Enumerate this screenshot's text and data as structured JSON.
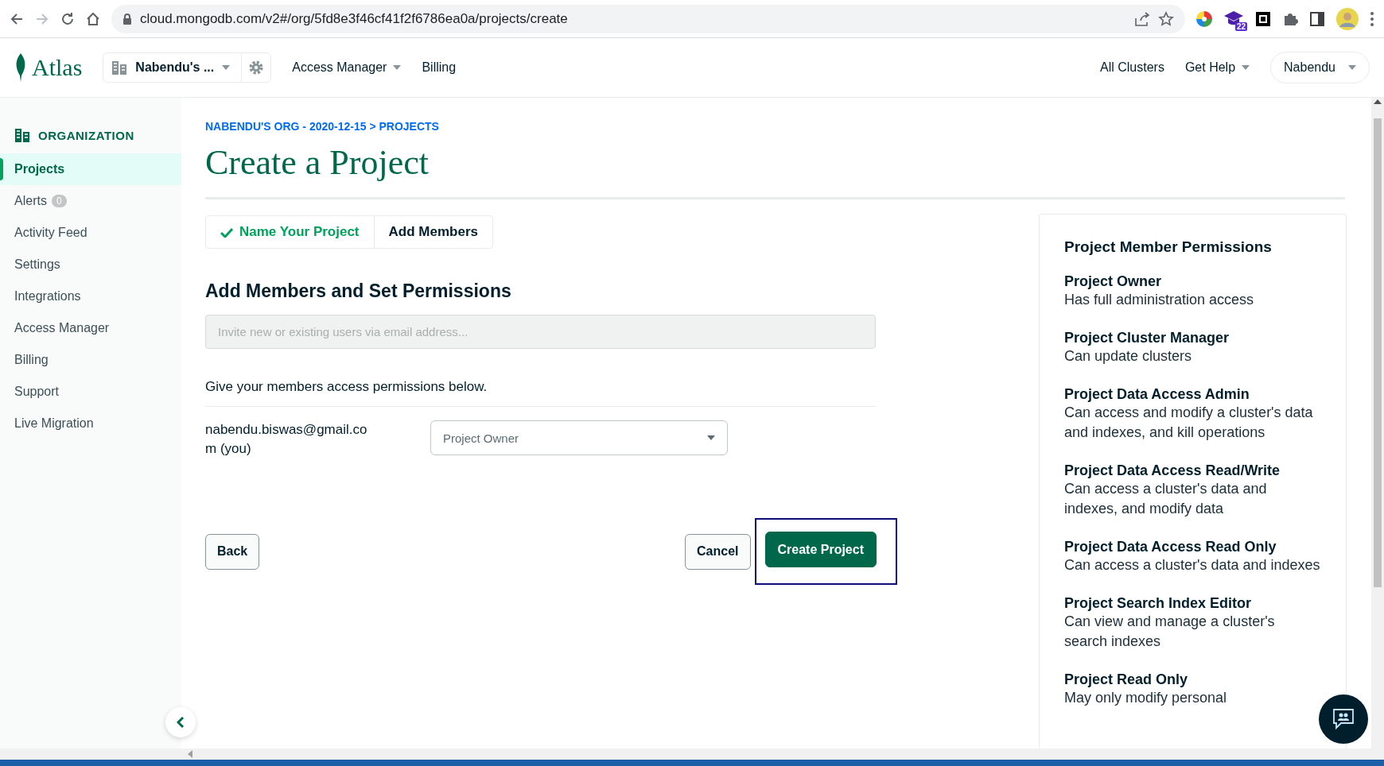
{
  "browser": {
    "url": "cloud.mongodb.com/v2#/org/5fd8e3f46cf41f2f6786ea0a/projects/create",
    "extension_badge": "22"
  },
  "header": {
    "logo": "Atlas",
    "org": "Nabendu's ...",
    "nav": [
      {
        "label": "Access Manager",
        "kind": "dropdown"
      },
      {
        "label": "Billing",
        "kind": "link"
      }
    ],
    "right": [
      {
        "label": "All Clusters",
        "kind": "link"
      },
      {
        "label": "Get Help",
        "kind": "dropdown"
      },
      {
        "label": "Nabendu",
        "kind": "user"
      }
    ]
  },
  "sidebar": {
    "section": "ORGANIZATION",
    "items": [
      {
        "label": "Projects",
        "selected": true
      },
      {
        "label": "Alerts",
        "badge": "0",
        "selected": false
      },
      {
        "label": "Activity Feed",
        "selected": false
      },
      {
        "label": "Settings",
        "selected": false
      },
      {
        "label": "Integrations",
        "selected": false
      },
      {
        "label": "Access Manager",
        "selected": false
      },
      {
        "label": "Billing",
        "selected": false
      },
      {
        "label": "Support",
        "selected": false
      },
      {
        "label": "Live Migration",
        "selected": false
      }
    ]
  },
  "breadcrumb": "NABENDU'S ORG - 2020-12-15 > PROJECTS",
  "title": "Create a Project",
  "steps": [
    {
      "label": "Name Your Project",
      "completed": true
    },
    {
      "label": "Add Members",
      "completed": false
    }
  ],
  "form": {
    "heading": "Add Members and Set Permissions",
    "invite": {
      "placeholder": "Invite new or existing users via email address..."
    },
    "hint": "Give your members access permissions below.",
    "members": [
      {
        "email": "nabendu.biswas@gmail.com (you)",
        "role": "Project Owner"
      }
    ]
  },
  "buttons": [
    {
      "label": "Back",
      "kind": "secondary",
      "focused": false
    },
    {
      "label": "Cancel",
      "kind": "secondary",
      "focused": false
    },
    {
      "label": "Create Project",
      "kind": "primary",
      "focused": true
    }
  ],
  "permissions": {
    "heading": "Project Member Permissions",
    "roles": [
      {
        "name": "Project Owner",
        "description": "Has full administration access"
      },
      {
        "name": "Project Cluster Manager",
        "description": "Can update clusters"
      },
      {
        "name": "Project Data Access Admin",
        "description": "Can access and modify a cluster's data and indexes, and kill operations"
      },
      {
        "name": "Project Data Access Read/Write",
        "description": "Can access a cluster's data and indexes, and modify data"
      },
      {
        "name": "Project Data Access Read Only",
        "description": "Can access a cluster's data and indexes"
      },
      {
        "name": "Project Search Index Editor",
        "description": "Can view and manage a cluster's search indexes"
      },
      {
        "name": "Project Read Only",
        "description": "May only modify personal"
      }
    ]
  }
}
